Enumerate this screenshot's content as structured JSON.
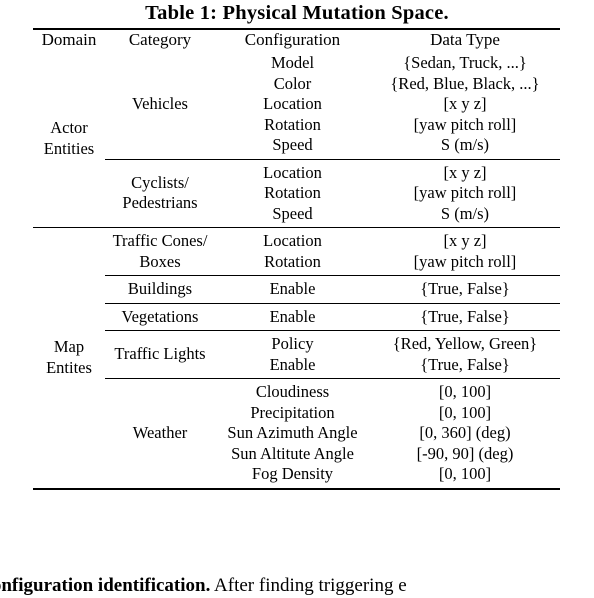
{
  "title": "Table 1: Physical Mutation Space.",
  "table": {
    "headers": [
      "Domain",
      "Category",
      "Configuration",
      "Data Type"
    ],
    "groups": [
      {
        "domain_lines": [
          "Actor",
          "Entities"
        ],
        "rows": [
          {
            "category_lines": [
              "Vehicles"
            ],
            "configuration_lines": [
              "Model",
              "Color",
              "Location",
              "Rotation",
              "Speed"
            ],
            "data_type_lines": [
              "{Sedan, Truck, ...}",
              "{Red, Blue, Black, ...}",
              "[x y z]",
              "[yaw pitch roll]",
              "S (m/s)"
            ]
          },
          {
            "category_lines": [
              "Cyclists/",
              "Pedestrians"
            ],
            "configuration_lines": [
              "Location",
              "Rotation",
              "Speed"
            ],
            "data_type_lines": [
              "[x y z]",
              "[yaw pitch roll]",
              "S (m/s)"
            ]
          }
        ]
      },
      {
        "domain_lines": [
          "Map",
          "Entites"
        ],
        "rows": [
          {
            "category_lines": [
              "Traffic Cones/",
              "Boxes"
            ],
            "configuration_lines": [
              "Location",
              "Rotation"
            ],
            "data_type_lines": [
              "[x y z]",
              "[yaw pitch roll]"
            ]
          },
          {
            "category_lines": [
              "Buildings"
            ],
            "configuration_lines": [
              "Enable"
            ],
            "data_type_lines": [
              "{True, False}"
            ]
          },
          {
            "category_lines": [
              "Vegetations"
            ],
            "configuration_lines": [
              "Enable"
            ],
            "data_type_lines": [
              "{True, False}"
            ]
          },
          {
            "category_lines": [
              "Traffic Lights"
            ],
            "configuration_lines": [
              "Policy",
              "Enable"
            ],
            "data_type_lines": [
              "{Red, Yellow, Green}",
              "{True, False}"
            ]
          },
          {
            "category_lines": [
              "Weather"
            ],
            "configuration_lines": [
              "Cloudiness",
              "Precipitation",
              "Sun Azimuth Angle",
              "Sun Altitute Angle",
              "Fog Density"
            ],
            "data_type_lines": [
              "[0, 100]",
              "[0, 100]",
              "[0, 360] (deg)",
              "[-90, 90] (deg)",
              "[0, 100]"
            ]
          }
        ]
      }
    ]
  },
  "body_text": {
    "bold_lead": "sconfiguration identification.",
    "rest": "After finding triggering e"
  }
}
